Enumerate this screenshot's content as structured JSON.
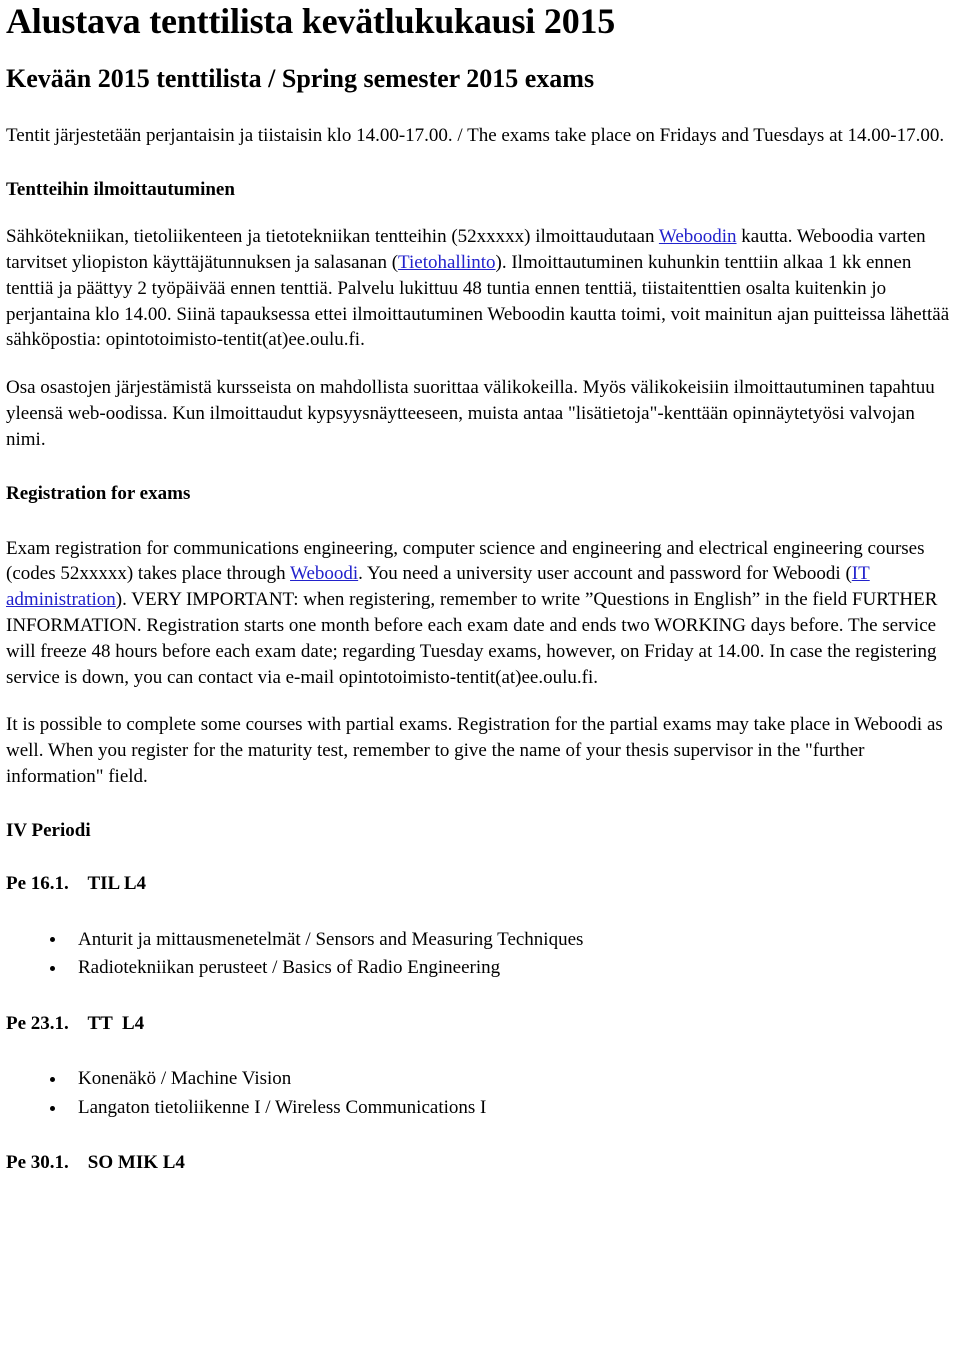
{
  "document": {
    "title": "Alustava tenttilista kevätlukukausi 2015",
    "subtitle": "Kevään 2015 tenttilista / Spring semester 2015 exams",
    "intro_paragraph": "Tentit järjestetään perjantaisin ja tiistaisin klo 14.00-17.00. / The exams take place on Fridays and Tuesdays at 14.00-17.00."
  },
  "sections": {
    "registration_fi": {
      "heading": "Tentteihin ilmoittautuminen",
      "paragraph_1": {
        "part_1": "Sähkötekniikan, tietoliikenteen ja tietotekniikan tentteihin (52xxxxx) ilmoittaudutaan ",
        "link_1": "Weboodin",
        "part_2": " kautta. Weboodia varten tarvitset yliopiston käyttäjätunnuksen ja salasanan (",
        "link_2": "Tietohallinto",
        "part_3": "). Ilmoittautuminen kuhunkin tenttiin alkaa 1 kk ennen tenttiä ja päättyy 2 työpäivää ennen tenttiä. Palvelu lukittuu 48 tuntia ennen tenttiä, tiistaitenttien osalta kuitenkin jo perjantaina klo 14.00. Siinä tapauksessa ettei ilmoittautuminen Weboodin kautta toimi, voit mainitun ajan puitteissa lähettää sähköpostia: opintotoimisto-tentit(at)ee.oulu.fi."
      },
      "paragraph_2": "Osa osastojen järjestämistä kursseista on mahdollista suorittaa välikokeilla. Myös välikokeisiin ilmoittautuminen tapahtuu yleensä web-oodissa. Kun ilmoittaudut kypsyysnäytteeseen, muista antaa \"lisätietoja\"-kenttään opinnäytetyösi valvojan nimi."
    },
    "registration_en": {
      "heading": "Registration for exams",
      "paragraph_1": {
        "part_1": "Exam registration for communications engineering, computer science and engineering and  electrical engineering courses (codes 52xxxxx) takes place through ",
        "link_1": "Weboodi",
        "part_2": ". You need a university user account and password for Weboodi (",
        "link_2": "IT administration",
        "part_3": "). VERY IMPORTANT: when registering, remember to write ”Questions in English” in the field FURTHER INFORMATION. Registration starts one month before each exam date and ends two WORKING days before. The service will freeze 48 hours before each exam date; regarding Tuesday exams, however, on Friday at 14.00. In case the registering service is down, you can contact via e-mail opintotoimisto-tentit(at)ee.oulu.fi."
      },
      "paragraph_2": "It is possible to complete some courses with partial exams. Registration for the partial exams may take place in Weboodi as well. When you register for the maturity test, remember to give the name of your thesis supervisor in the \"further information\" field."
    }
  },
  "schedule": {
    "period_heading": "IV Periodi",
    "entries": [
      {
        "heading": "Pe 16.1.    TIL L4",
        "courses": [
          "Anturit ja mittausmenetelmät / Sensors and Measuring Techniques",
          "Radiotekniikan perusteet / Basics of Radio Engineering"
        ]
      },
      {
        "heading": "Pe 23.1.    TT  L4",
        "courses": [
          "Konenäkö / Machine Vision",
          "Langaton tietoliikenne I / Wireless Communications I"
        ]
      },
      {
        "heading": "Pe 30.1.    SO MIK L4",
        "courses": []
      }
    ]
  },
  "theme": {
    "link_color": "#2222cc",
    "text_color": "#000000",
    "background_color": "#ffffff"
  }
}
